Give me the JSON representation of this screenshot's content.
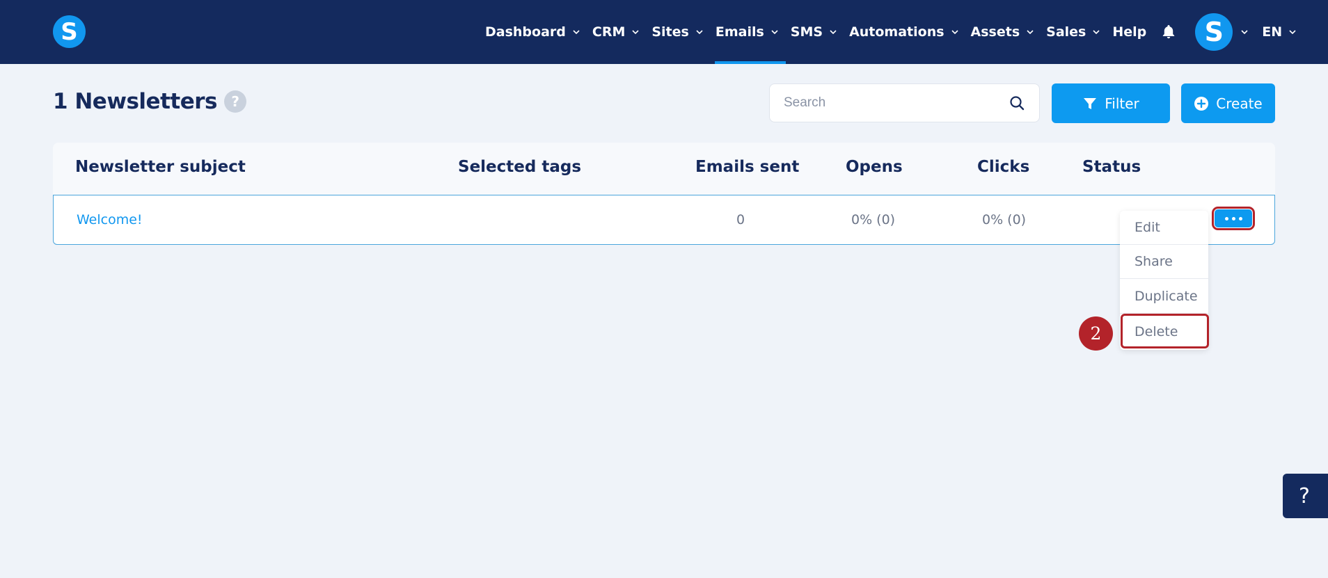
{
  "brand": {
    "logo_letter": "S"
  },
  "nav": {
    "items": [
      {
        "label": "Dashboard",
        "has_dropdown": true
      },
      {
        "label": "CRM",
        "has_dropdown": true
      },
      {
        "label": "Sites",
        "has_dropdown": true
      },
      {
        "label": "Emails",
        "has_dropdown": true,
        "active": true
      },
      {
        "label": "SMS",
        "has_dropdown": true
      },
      {
        "label": "Automations",
        "has_dropdown": true
      },
      {
        "label": "Assets",
        "has_dropdown": true
      },
      {
        "label": "Sales",
        "has_dropdown": true
      },
      {
        "label": "Help",
        "has_dropdown": false
      }
    ],
    "bell_icon": "bell-icon",
    "avatar_letter": "S",
    "language": "EN"
  },
  "page": {
    "title": "1 Newsletters",
    "help_glyph": "?",
    "search_placeholder": "Search",
    "filter_label": "Filter",
    "create_label": "Create"
  },
  "table": {
    "columns": [
      "Newsletter subject",
      "Selected tags",
      "Emails sent",
      "Opens",
      "Clicks",
      "Status"
    ],
    "rows": [
      {
        "subject": "Welcome!",
        "tags": "",
        "emails_sent": "0",
        "opens": "0% (0)",
        "clicks": "0% (0)",
        "status": ""
      }
    ]
  },
  "row_menu": {
    "items": [
      "Edit",
      "Share",
      "Duplicate",
      "Delete"
    ],
    "highlighted": "Delete"
  },
  "annotation": {
    "step_number": "2"
  },
  "floating_help": {
    "glyph": "?"
  },
  "colors": {
    "navbar": "#142a5e",
    "accent": "#0d9af0",
    "highlight": "#b3232a",
    "background": "#eff3f9"
  }
}
